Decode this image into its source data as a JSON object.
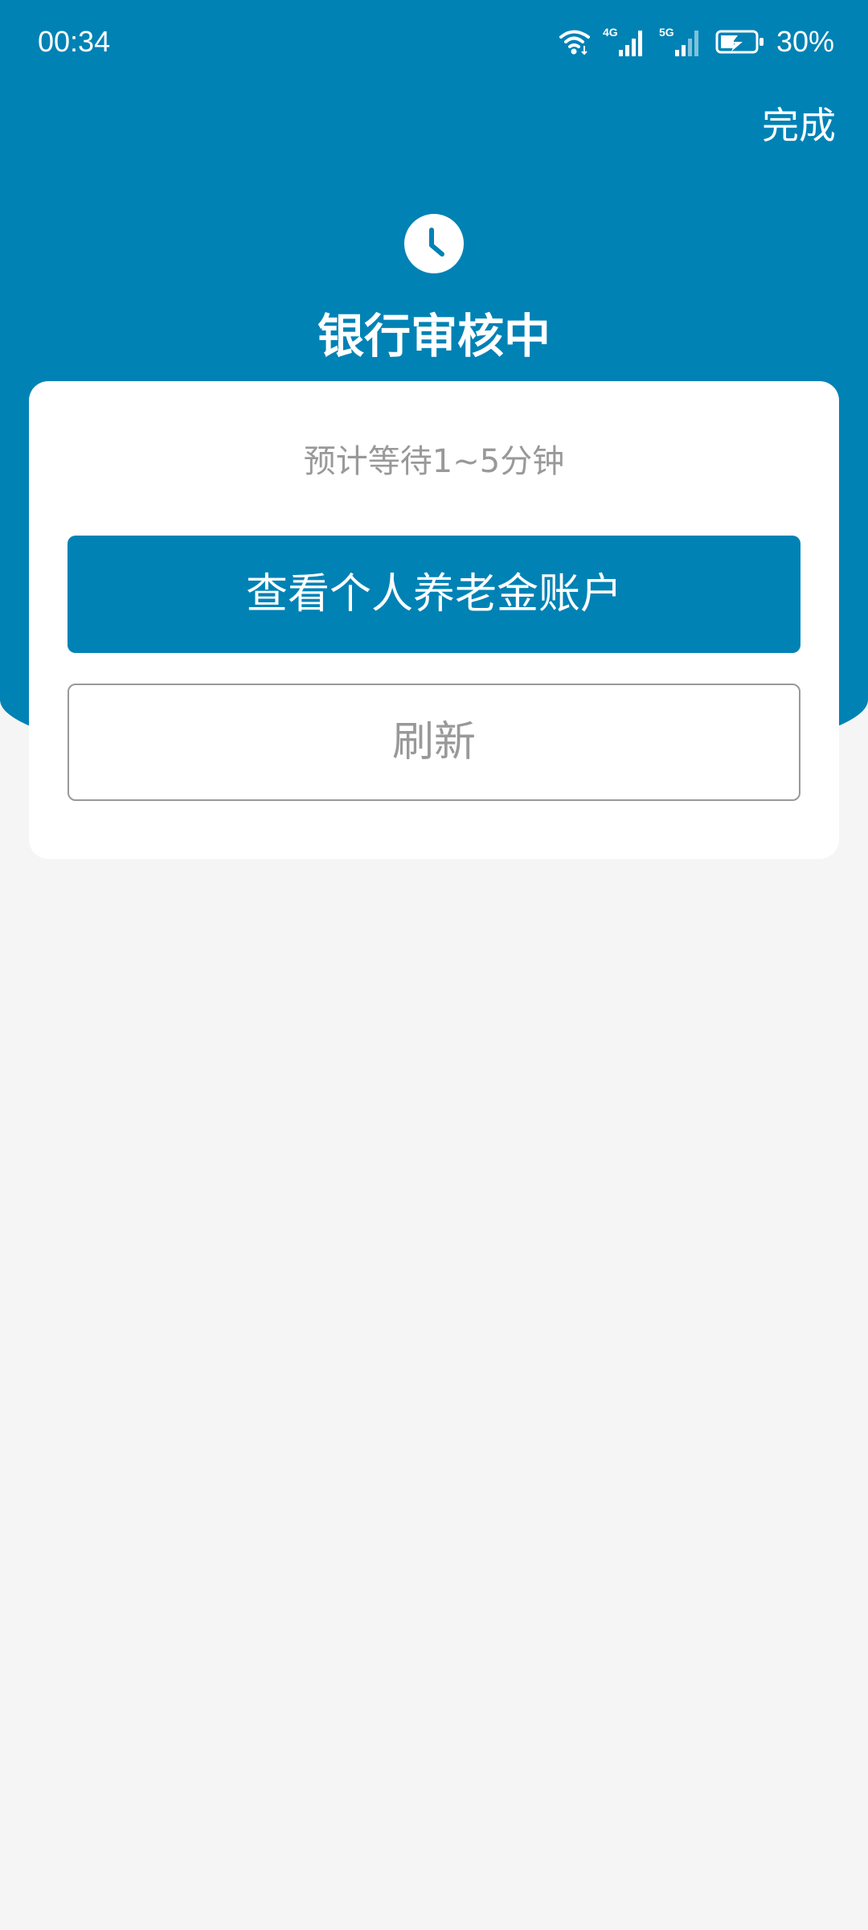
{
  "status_bar": {
    "time": "00:34",
    "network_4g_label": "4G",
    "network_5g_label": "5G",
    "battery_percent": "30%",
    "icons": [
      "wifi-icon",
      "signal-4g-icon",
      "signal-5g-icon",
      "battery-charging-icon"
    ]
  },
  "header": {
    "done_label": "完成",
    "status_icon": "clock-icon",
    "title": "银行审核中"
  },
  "card": {
    "wait_text": "预计等待1~5分钟",
    "primary_button_label": "查看个人养老金账户",
    "secondary_button_label": "刷新"
  },
  "colors": {
    "brand_blue": "#0082b5",
    "background": "#f5f5f5",
    "card": "#ffffff",
    "muted_text": "#999999"
  }
}
